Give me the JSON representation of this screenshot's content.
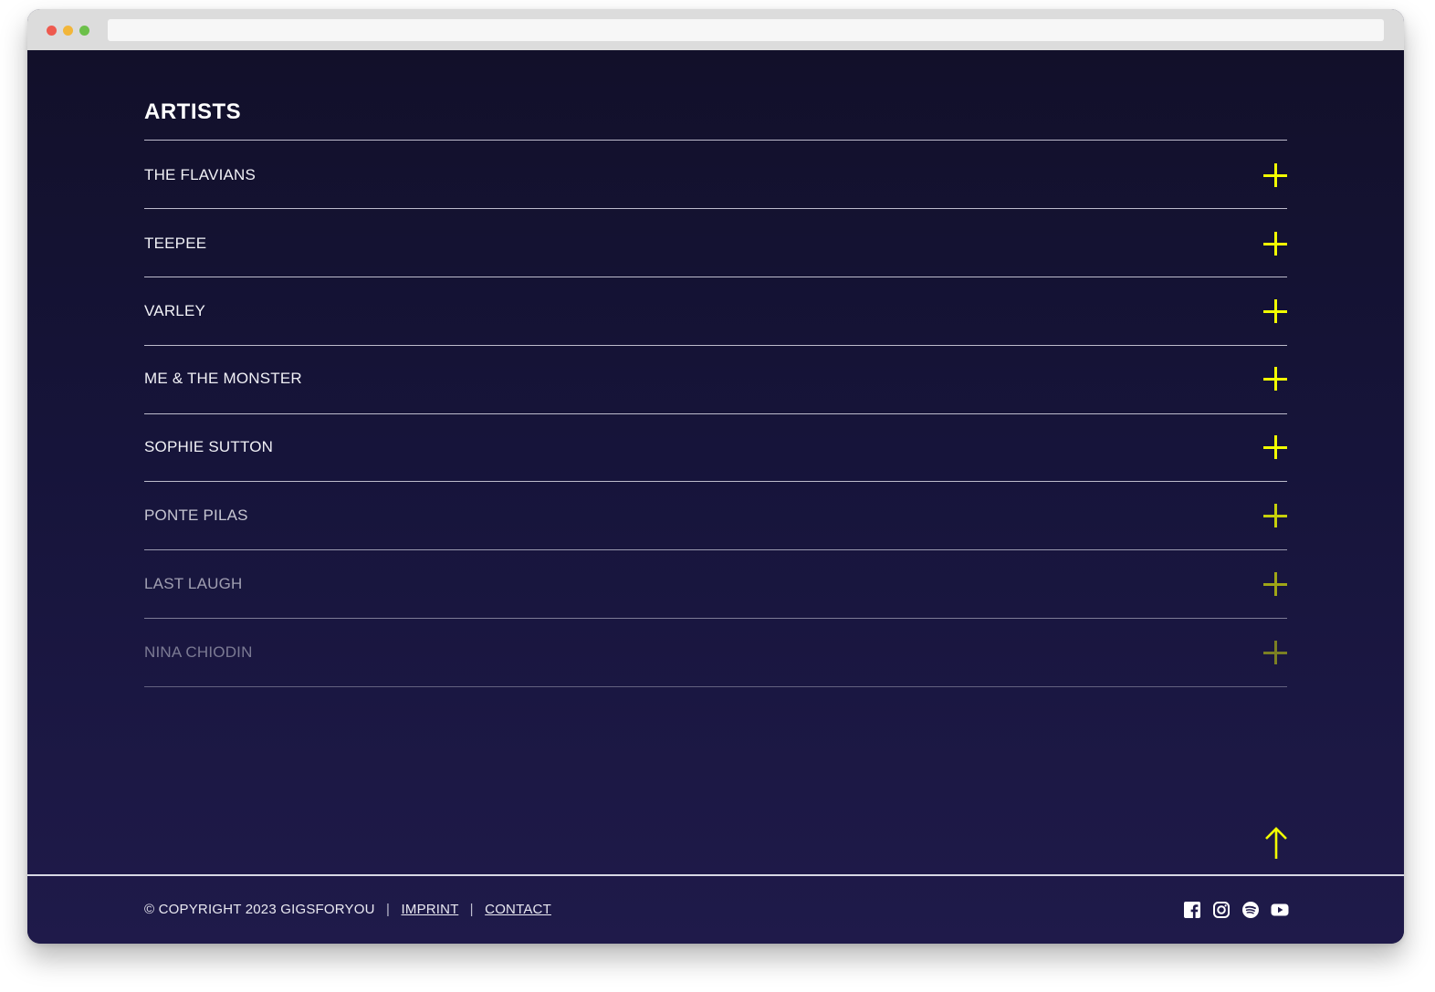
{
  "page": {
    "heading": "ARTISTS",
    "accent_color": "#f2ff00"
  },
  "artists": [
    {
      "name": "THE FLAVIANS",
      "icon": "plus-icon"
    },
    {
      "name": "TEEPEE",
      "icon": "plus-icon"
    },
    {
      "name": "VARLEY",
      "icon": "plus-icon"
    },
    {
      "name": "ME & THE MONSTER",
      "icon": "plus-icon"
    },
    {
      "name": "SOPHIE SUTTON",
      "icon": "plus-icon"
    },
    {
      "name": "PONTE PILAS",
      "icon": "plus-icon"
    },
    {
      "name": "LAST LAUGH",
      "icon": "plus-icon"
    },
    {
      "name": "NINA CHIODIN",
      "icon": "plus-icon"
    }
  ],
  "back_to_top_icon": "arrow-up-icon",
  "footer": {
    "copyright": "© COPYRIGHT 2023 GIGSFORYOU",
    "separator": "|",
    "imprint_label": "IMPRINT",
    "contact_label": "CONTACT",
    "socials": [
      "facebook-icon",
      "instagram-icon",
      "spotify-icon",
      "youtube-icon"
    ]
  }
}
